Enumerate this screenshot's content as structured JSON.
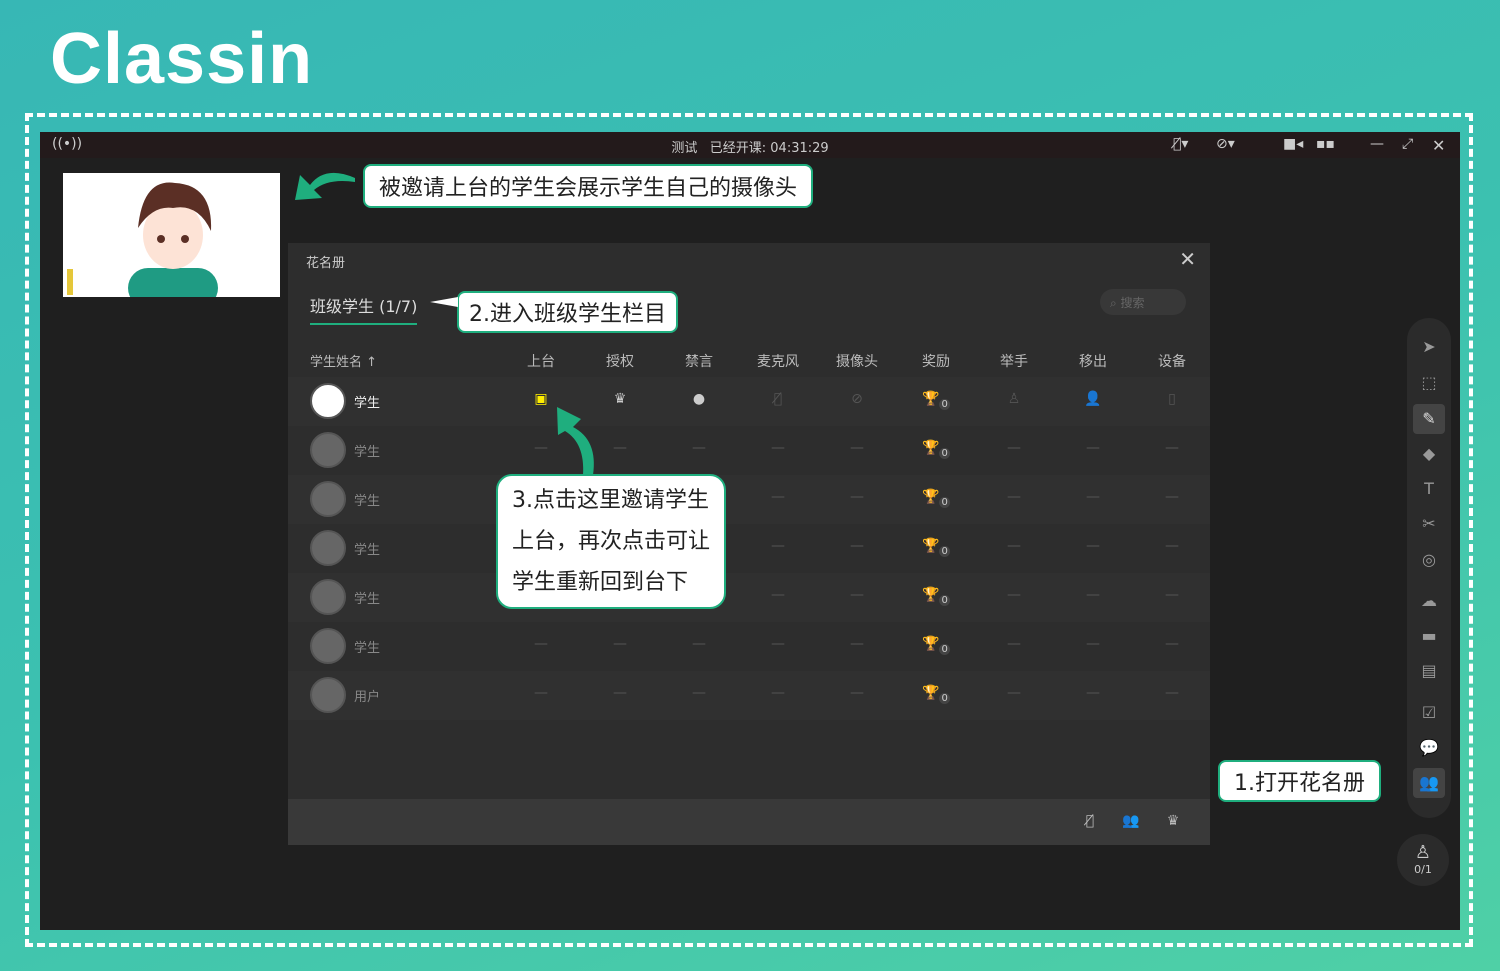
{
  "brand": "Classin",
  "titlebar": {
    "course": "测试",
    "elapsed_label": "已经开课:",
    "elapsed": "04:31:29"
  },
  "callouts": {
    "camera": "被邀请上台的学生会展示学生自己的摄像头",
    "step2": "2.进入班级学生栏目",
    "step3": [
      "3.点击这里邀请学生",
      "上台，再次点击可让",
      "学生重新回到台下"
    ],
    "step1": "1.打开花名册"
  },
  "roster": {
    "title": "花名册",
    "tab": "班级学生 (1/7)",
    "search_placeholder": "搜索",
    "columns": [
      "学生姓名 ↑",
      "上台",
      "授权",
      "禁言",
      "麦克风",
      "摄像头",
      "奖励",
      "举手",
      "移出",
      "设备"
    ],
    "rows": [
      {
        "name": "学生",
        "reward": "0"
      },
      {
        "name": "学生",
        "reward": "0"
      },
      {
        "name": "学生",
        "reward": "0"
      },
      {
        "name": "学生",
        "reward": "0"
      },
      {
        "name": "学生",
        "reward": "0"
      },
      {
        "name": "学生",
        "reward": "0"
      },
      {
        "name": "用户",
        "reward": "0"
      }
    ],
    "placeholder": "—"
  },
  "seat": {
    "count": "0/1"
  },
  "colors": {
    "accent": "#1fae7e",
    "stage": "#ffee00"
  }
}
